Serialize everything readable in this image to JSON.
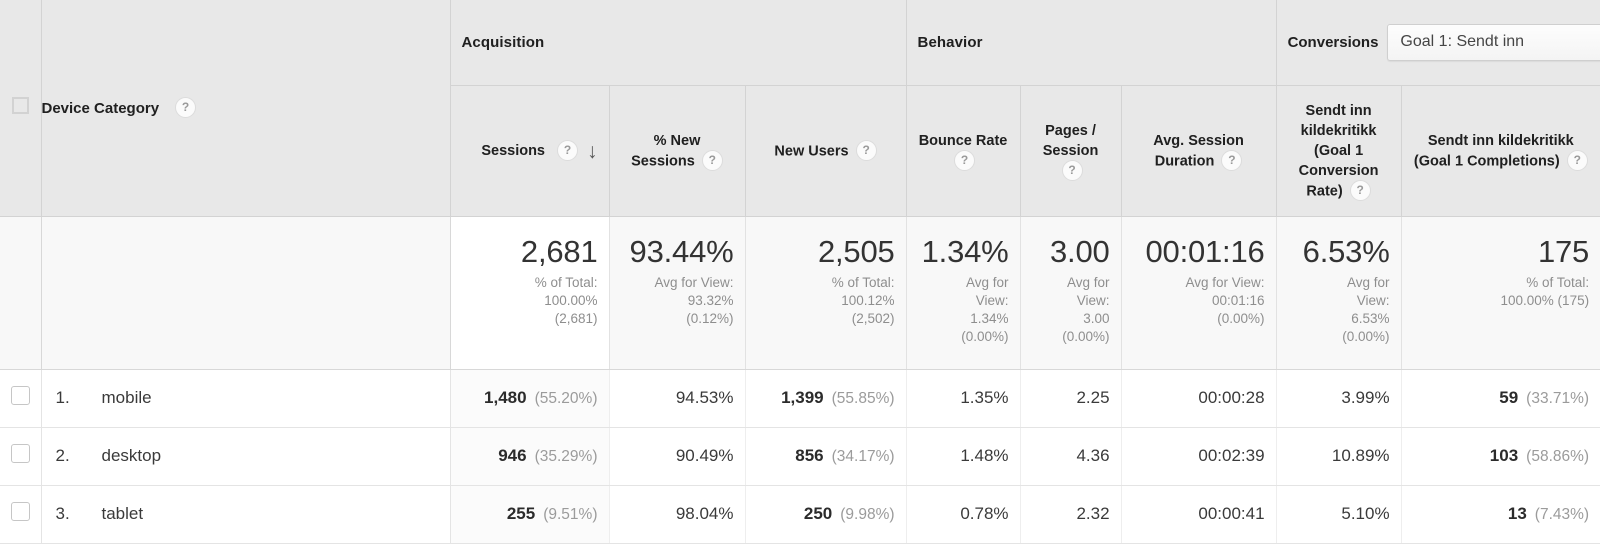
{
  "table": {
    "groups": {
      "dimension": "Device Category",
      "acquisition": "Acquisition",
      "behavior": "Behavior",
      "conversions": "Conversions"
    },
    "goal_select": {
      "value": "Goal 1: Sendt inn",
      "icon": "chevron-down-icon"
    },
    "help_icon_glyph": "?",
    "sort_arrow_glyph": "↓",
    "columns": [
      {
        "id": "sessions",
        "label": "Sessions",
        "help": true,
        "sorted": true,
        "align": "right"
      },
      {
        "id": "pct_new_sessions",
        "label": "% New Sessions",
        "help": true,
        "sorted": false,
        "align": "center"
      },
      {
        "id": "new_users",
        "label": "New Users",
        "help": true,
        "sorted": false,
        "align": "center"
      },
      {
        "id": "bounce_rate",
        "label": "Bounce Rate",
        "help": true,
        "sorted": false,
        "align": "center"
      },
      {
        "id": "pages_session",
        "label": "Pages / Session",
        "help": true,
        "sorted": false,
        "align": "center"
      },
      {
        "id": "avg_session_duration",
        "label": "Avg. Session Duration",
        "help": true,
        "sorted": false,
        "align": "center"
      },
      {
        "id": "goal1_conv_rate",
        "label": "Sendt inn kildekritikk (Goal 1 Conversion Rate)",
        "help": true,
        "sorted": false,
        "align": "center"
      },
      {
        "id": "goal1_completions",
        "label": "Sendt inn kildekritikk (Goal 1 Completions)",
        "help": true,
        "sorted": false,
        "align": "center"
      }
    ],
    "summary": {
      "sessions": {
        "value": "2,681",
        "sub": "% of Total:\n100.00%\n(2,681)"
      },
      "pct_new_sessions": {
        "value": "93.44%",
        "sub": "Avg for View:\n93.32%\n(0.12%)"
      },
      "new_users": {
        "value": "2,505",
        "sub": "% of Total:\n100.12%\n(2,502)"
      },
      "bounce_rate": {
        "value": "1.34%",
        "sub": "Avg for\nView:\n1.34%\n(0.00%)"
      },
      "pages_session": {
        "value": "3.00",
        "sub": "Avg for\nView:\n3.00\n(0.00%)"
      },
      "avg_session_duration": {
        "value": "00:01:16",
        "sub": "Avg for View:\n00:01:16\n(0.00%)"
      },
      "goal1_conv_rate": {
        "value": "6.53%",
        "sub": "Avg for\nView:\n6.53%\n(0.00%)"
      },
      "goal1_completions": {
        "value": "175",
        "sub": "% of Total:\n100.00% (175)"
      }
    },
    "rows": [
      {
        "index": "1.",
        "label": "mobile",
        "sessions": "1,480",
        "sessions_pct": "(55.20%)",
        "pct_new_sessions": "94.53%",
        "new_users": "1,399",
        "new_users_pct": "(55.85%)",
        "bounce_rate": "1.35%",
        "pages_session": "2.25",
        "avg_session_duration": "00:00:28",
        "goal1_conv_rate": "3.99%",
        "goal1_completions": "59",
        "goal1_completions_pct": "(33.71%)"
      },
      {
        "index": "2.",
        "label": "desktop",
        "sessions": "946",
        "sessions_pct": "(35.29%)",
        "pct_new_sessions": "90.49%",
        "new_users": "856",
        "new_users_pct": "(34.17%)",
        "bounce_rate": "1.48%",
        "pages_session": "4.36",
        "avg_session_duration": "00:02:39",
        "goal1_conv_rate": "10.89%",
        "goal1_completions": "103",
        "goal1_completions_pct": "(58.86%)"
      },
      {
        "index": "3.",
        "label": "tablet",
        "sessions": "255",
        "sessions_pct": "(9.51%)",
        "pct_new_sessions": "98.04%",
        "new_users": "250",
        "new_users_pct": "(9.98%)",
        "bounce_rate": "0.78%",
        "pages_session": "2.32",
        "avg_session_duration": "00:00:41",
        "goal1_conv_rate": "5.10%",
        "goal1_completions": "13",
        "goal1_completions_pct": "(7.43%)"
      }
    ]
  }
}
